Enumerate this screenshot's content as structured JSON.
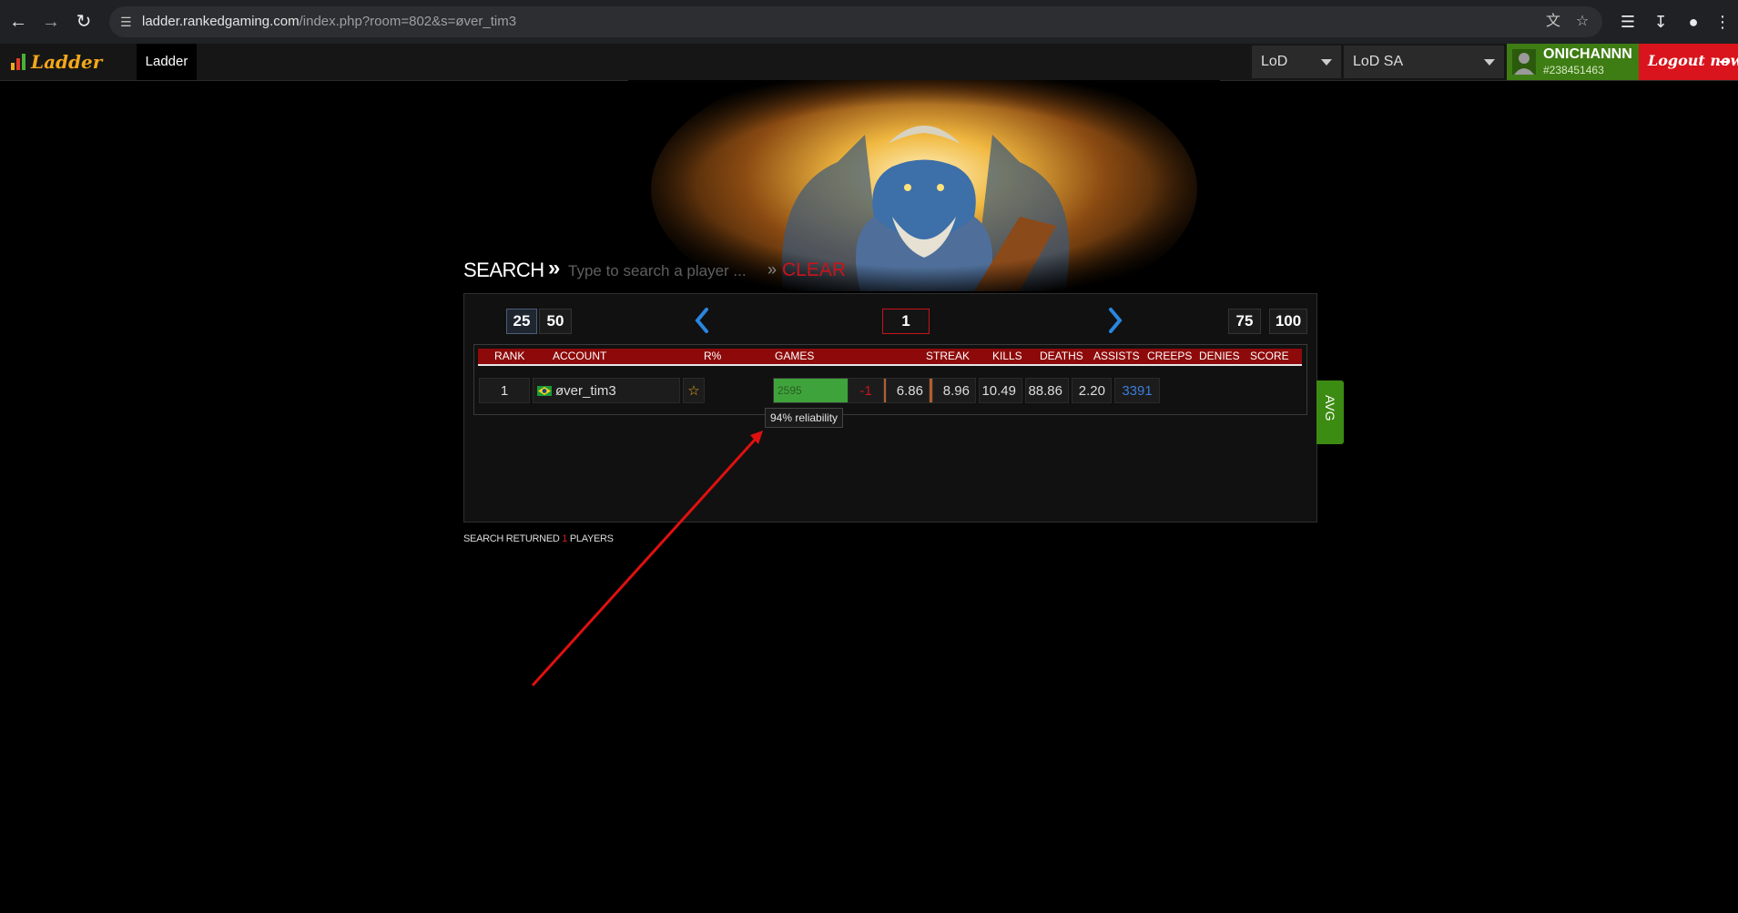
{
  "browser": {
    "url_host": "ladder.rankedgaming.com",
    "url_rest": "/index.php?room=802&s=øver_tim3"
  },
  "header": {
    "logo_text": "Ladder",
    "nav_tab": "Ladder",
    "mode_select": "LoD",
    "region_select": "LoD SA",
    "user_name": "ONICHANNN",
    "user_id": "#238451463",
    "logout_label": "Logout now"
  },
  "search": {
    "label": "SEARCH",
    "separator": "»",
    "placeholder": "Type to search a player ...",
    "clear_separator": "»",
    "clear_label": "CLEAR"
  },
  "pagination": {
    "size_25": "25",
    "size_50": "50",
    "current_page": "1",
    "size_75": "75",
    "size_100": "100"
  },
  "table": {
    "headers": {
      "rank": "RANK",
      "account": "ACCOUNT",
      "rpct": "R%",
      "games": "GAMES",
      "streak": "STREAK",
      "kills": "KILLS",
      "deaths": "DEATHS",
      "assists": "ASSISTS",
      "creeps": "CREEPS",
      "denies": "DENIES",
      "score": "SCORE"
    },
    "rows": [
      {
        "rank": "1",
        "account": "øver_tim3",
        "games": "2595",
        "games_bar_fraction": 0.47,
        "streak": "-1",
        "kills": "6.86",
        "deaths": "8.96",
        "assists": "10.49",
        "creeps": "88.86",
        "denies": "2.20",
        "score": "3391"
      }
    ],
    "tooltip": "94% reliability"
  },
  "avg_tab": "AVG",
  "results": {
    "prefix": "SEARCH RETURNED",
    "count": "1",
    "suffix": "PLAYERS"
  },
  "colors": {
    "brand_orange": "#f3a81b",
    "header_red": "#8e0a0a",
    "logout_red": "#d9141c",
    "user_green": "#3e7d13",
    "win_green": "#3fa33b",
    "loss_orange": "#b45e2a",
    "score_blue": "#3b7dd8",
    "annotation_red": "#e01010"
  }
}
